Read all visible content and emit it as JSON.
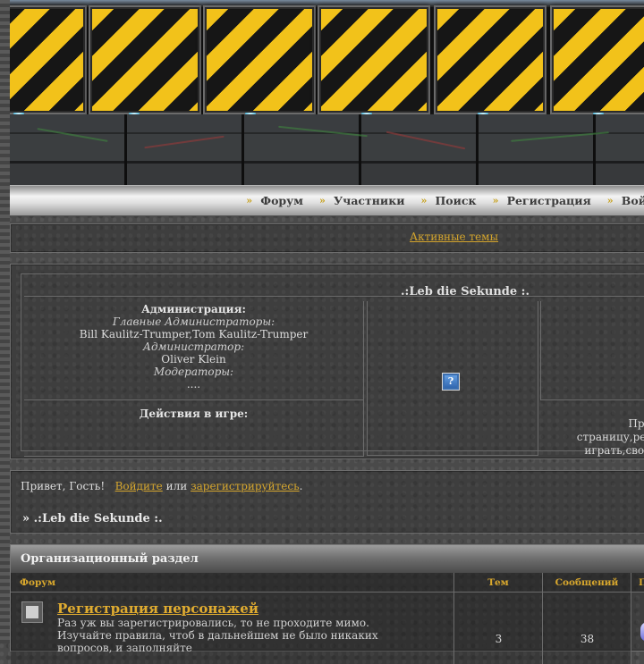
{
  "nav": {
    "items": [
      {
        "label": "Форум"
      },
      {
        "label": "Участники"
      },
      {
        "label": "Поиск"
      },
      {
        "label": "Регистрация"
      },
      {
        "label": "Войти"
      }
    ]
  },
  "active_topics": {
    "label": "Активные темы"
  },
  "info": {
    "title": ".:Leb die Sekunde :.",
    "admin_heading": "Администрация:",
    "chief_admins_label": "Главные Администраторы:",
    "chief_admins": "Bill Kaulitz-Trumper,Tom Kaulitz-Trumper",
    "admin_label": "Администратор:",
    "admin": "Oliver Klein",
    "moderators_label": "Модераторы:",
    "moderators": "....",
    "game_actions_heading": "Действия в игре:",
    "right_text_1": "Прекра",
    "right_text_2": "страницу,регист",
    "right_text_3": "играть,свободн"
  },
  "greeting": {
    "hello": "Привет, Гость!",
    "login_link": "Войдите",
    "or": "или",
    "register_link": "зарегистрируйтесь",
    "period": "."
  },
  "breadcrumb": "» .:Leb die Sekunde :.",
  "section": {
    "title": "Организационный раздел",
    "columns": {
      "forum": "Форум",
      "topics": "Тем",
      "messages": "Сообщений",
      "last": "П"
    },
    "forums": [
      {
        "title": "Регистрация персонажей",
        "desc": "Раз уж вы зарегистрировались, то не проходите мимо. Изучайте правила, чтоб в дальнейшем не было никаких вопросов, и заполняйте",
        "topics": "3",
        "messages": "38"
      }
    ]
  },
  "colors": {
    "accent": "#d4a52d",
    "hazard_yellow": "#f2c21a"
  }
}
